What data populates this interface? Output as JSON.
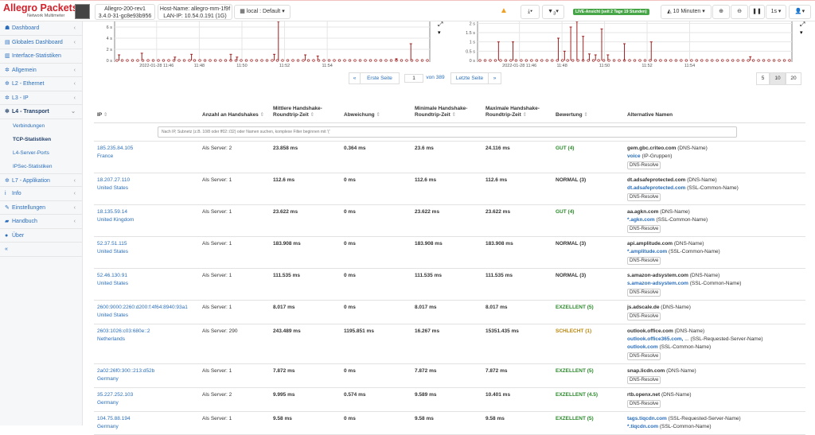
{
  "header": {
    "logo": "Allegro Packets",
    "logo_sub": "Network Multimeter",
    "device": "Allegro-200-rev1",
    "version": "3.4.0-31-gc8e93b956",
    "hostname": "Host-Name: allegro-mm-1f9f",
    "lan_ip": "LAN-IP: 10.54.0.191 (1G)",
    "workspace": "local : Default",
    "filter_count": "3",
    "live": "LIVE-Ansicht (seit 2 Tage 19 Stunden)",
    "timespan": "10 Minuten",
    "interval": "1s"
  },
  "sidebar": {
    "items": [
      {
        "label": "Dashboard",
        "icon": "dashboard-icon",
        "chev": true
      },
      {
        "label": "Globales Dashboard",
        "icon": "table-icon",
        "chev": true
      },
      {
        "label": "Interface-Statistiken",
        "icon": "chart-icon",
        "chev": false
      },
      {
        "label": "Allgemein",
        "icon": "gear-icon",
        "chev": true
      },
      {
        "label": "L2 - Ethernet",
        "icon": "gear-icon",
        "chev": true
      },
      {
        "label": "L3 - IP",
        "icon": "gear-icon",
        "chev": true
      },
      {
        "label": "L4 - Transport",
        "icon": "gear-icon",
        "chev": true
      }
    ],
    "sub": [
      "Verbindungen",
      "TCP-Statistiken",
      "L4-Server-Ports",
      "IPSec-Statistiken"
    ],
    "items2": [
      {
        "label": "L7 - Applikation",
        "chev": true
      },
      {
        "label": "Info",
        "chev": true
      },
      {
        "label": "Einstellungen",
        "chev": true
      },
      {
        "label": "Handbuch",
        "chev": true
      },
      {
        "label": "Über",
        "chev": false
      }
    ],
    "collapse": "«"
  },
  "chart_data": [
    {
      "type": "line",
      "ylabel": "s",
      "yticks": [
        "0 s",
        "2 s",
        "4 s",
        "6 s"
      ],
      "ylim": [
        0,
        7
      ],
      "xticks": [
        "2022-01-28 11:46",
        "11:48",
        "11:50",
        "11:52",
        "11:54"
      ],
      "spikes": [
        [
          0.1,
          1
        ],
        [
          1.2,
          1.3
        ],
        [
          2.8,
          0.6
        ],
        [
          3.6,
          1.1
        ],
        [
          5.5,
          1.1
        ],
        [
          5.8,
          0.6
        ],
        [
          7.6,
          1.1
        ],
        [
          7.8,
          7
        ],
        [
          9.1,
          1
        ],
        [
          9.7,
          0.8
        ],
        [
          13.5,
          0.3
        ],
        [
          14.2,
          3
        ]
      ]
    },
    {
      "type": "line",
      "ylabel": "s",
      "yticks": [
        "0 s",
        "0.5 s",
        "1 s",
        "1.5 s",
        "2 s"
      ],
      "ylim": [
        0,
        2.1
      ],
      "xticks": [
        "2022-01-28 11:46",
        "11:48",
        "11:50",
        "11:52",
        "11:54"
      ],
      "spikes": [
        [
          0.9,
          1
        ],
        [
          1.6,
          1
        ],
        [
          3.8,
          1.2
        ],
        [
          4.1,
          0.5
        ],
        [
          4.4,
          1.8
        ],
        [
          4.7,
          2.1
        ],
        [
          5.0,
          1.3
        ],
        [
          5.3,
          0.35
        ],
        [
          5.6,
          0.3
        ],
        [
          5.9,
          1.7
        ],
        [
          6.2,
          0.3
        ],
        [
          7.0,
          0.9
        ],
        [
          8.3,
          1
        ],
        [
          13.1,
          0.2
        ]
      ]
    }
  ],
  "pagination": {
    "prev": "«",
    "first": "Erste Seite",
    "page": "1",
    "of": "von 389",
    "last": "Letzte Seite",
    "next": "»",
    "sizes": [
      "5",
      "10",
      "20"
    ]
  },
  "table": {
    "headers": [
      "IP",
      "Anzahl an Handshakes",
      "Mittlere Handshake-Roundtrip-Zeit",
      "Abweichung",
      "Minimale Handshake-Roundtrip-Zeit",
      "Maximale Handshake-Roundtrip-Zeit",
      "Bewertung",
      "Alternative Namen"
    ],
    "filter_placeholder": "Nach IP, Subnetz (z.B. 10/8 oder ff02::/32) oder Namen suchen, komplexe Filter beginnen mit '('",
    "dns_button": "DNS-Resolve",
    "rows": [
      {
        "ip": "185.235.84.105",
        "country": "France",
        "count": "Als Server: 2",
        "avg": "23.858 ms",
        "dev": "0.364 ms",
        "min": "23.6 ms",
        "max": "24.116 ms",
        "rating": "GUT (4)",
        "cls": "g",
        "names": [
          {
            "n": "gem.gbc.criteo.com",
            "t": "(DNS-Name)",
            "link": false
          },
          {
            "n": "voice",
            "t": "(IP-Gruppen)",
            "link": true
          }
        ]
      },
      {
        "ip": "18.207.27.110",
        "country": "United States",
        "count": "Als Server: 1",
        "avg": "112.6 ms",
        "dev": "0 ms",
        "min": "112.6 ms",
        "max": "112.6 ms",
        "rating": "NORMAL (3)",
        "cls": "n",
        "names": [
          {
            "n": "dt.adsafeprotected.com",
            "t": "(DNS-Name)",
            "link": false
          },
          {
            "n": "dt.adsafeprotected.com",
            "t": "(SSL-Common-Name)",
            "link": true
          }
        ]
      },
      {
        "ip": "18.135.59.14",
        "country": "United Kingdom",
        "count": "Als Server: 1",
        "avg": "23.622 ms",
        "dev": "0 ms",
        "min": "23.622 ms",
        "max": "23.622 ms",
        "rating": "GUT (4)",
        "cls": "g",
        "names": [
          {
            "n": "aa.agkn.com",
            "t": "(DNS-Name)",
            "link": false
          },
          {
            "n": "*.agkn.com",
            "t": "(SSL-Common-Name)",
            "link": true
          }
        ]
      },
      {
        "ip": "52.37.51.115",
        "country": "United States",
        "count": "Als Server: 1",
        "avg": "183.908 ms",
        "dev": "0 ms",
        "min": "183.908 ms",
        "max": "183.908 ms",
        "rating": "NORMAL (3)",
        "cls": "n",
        "names": [
          {
            "n": "api.amplitude.com",
            "t": "(DNS-Name)",
            "link": false
          },
          {
            "n": "*.amplitude.com",
            "t": "(SSL-Common-Name)",
            "link": true
          }
        ]
      },
      {
        "ip": "52.46.130.91",
        "country": "United States",
        "count": "Als Server: 1",
        "avg": "111.535 ms",
        "dev": "0 ms",
        "min": "111.535 ms",
        "max": "111.535 ms",
        "rating": "NORMAL (3)",
        "cls": "n",
        "names": [
          {
            "n": "s.amazon-adsystem.com",
            "t": "(DNS-Name)",
            "link": false
          },
          {
            "n": "s.amazon-adsystem.com",
            "t": "(SSL-Common-Name)",
            "link": true
          }
        ]
      },
      {
        "ip": "2600:9000:2260:d200:f:4f64:8940:93a1",
        "country": "United States",
        "count": "Als Server: 1",
        "avg": "8.017 ms",
        "dev": "0 ms",
        "min": "8.017 ms",
        "max": "8.017 ms",
        "rating": "EXZELLENT (5)",
        "cls": "g",
        "names": [
          {
            "n": "js.adscale.de",
            "t": "(DNS-Name)",
            "link": false
          }
        ]
      },
      {
        "ip": "2603:1026:c03:680e::2",
        "country": "Netherlands",
        "count": "Als Server: 290",
        "avg": "243.489 ms",
        "dev": "1195.851 ms",
        "min": "16.267 ms",
        "max": "15351.435 ms",
        "rating": "SCHLECHT (1)",
        "cls": "bad",
        "names": [
          {
            "n": "outlook.office.com",
            "t": "(DNS-Name)",
            "link": false
          },
          {
            "n": "outlook.office365.com,",
            "t": "... (SSL-Requested-Server-Name)",
            "link": true
          },
          {
            "n": "outlook.com",
            "t": "(SSL-Common-Name)",
            "link": true
          }
        ]
      },
      {
        "ip": "2a02:26f0:300::213:d52b",
        "country": "Germany",
        "count": "Als Server: 1",
        "avg": "7.872 ms",
        "dev": "0 ms",
        "min": "7.872 ms",
        "max": "7.872 ms",
        "rating": "EXZELLENT (5)",
        "cls": "g",
        "names": [
          {
            "n": "snap.licdn.com",
            "t": "(DNS-Name)",
            "link": false
          }
        ]
      },
      {
        "ip": "35.227.252.103",
        "country": "Germany",
        "count": "Als Server: 2",
        "avg": "9.995 ms",
        "dev": "0.574 ms",
        "min": "9.589 ms",
        "max": "10.401 ms",
        "rating": "EXZELLENT (4.5)",
        "cls": "g",
        "names": [
          {
            "n": "rtb.openx.net",
            "t": "(DNS-Name)",
            "link": false
          }
        ]
      },
      {
        "ip": "104.75.88.194",
        "country": "Germany",
        "count": "Als Server: 1",
        "avg": "9.58 ms",
        "dev": "0 ms",
        "min": "9.58 ms",
        "max": "9.58 ms",
        "rating": "EXZELLENT (5)",
        "cls": "g",
        "names": [
          {
            "n": "tags.tiqcdn.com",
            "t": "(SSL-Requested-Server-Name)",
            "link": true
          },
          {
            "n": "*.tiqcdn.com",
            "t": "(SSL-Common-Name)",
            "link": true
          }
        ]
      }
    ]
  }
}
